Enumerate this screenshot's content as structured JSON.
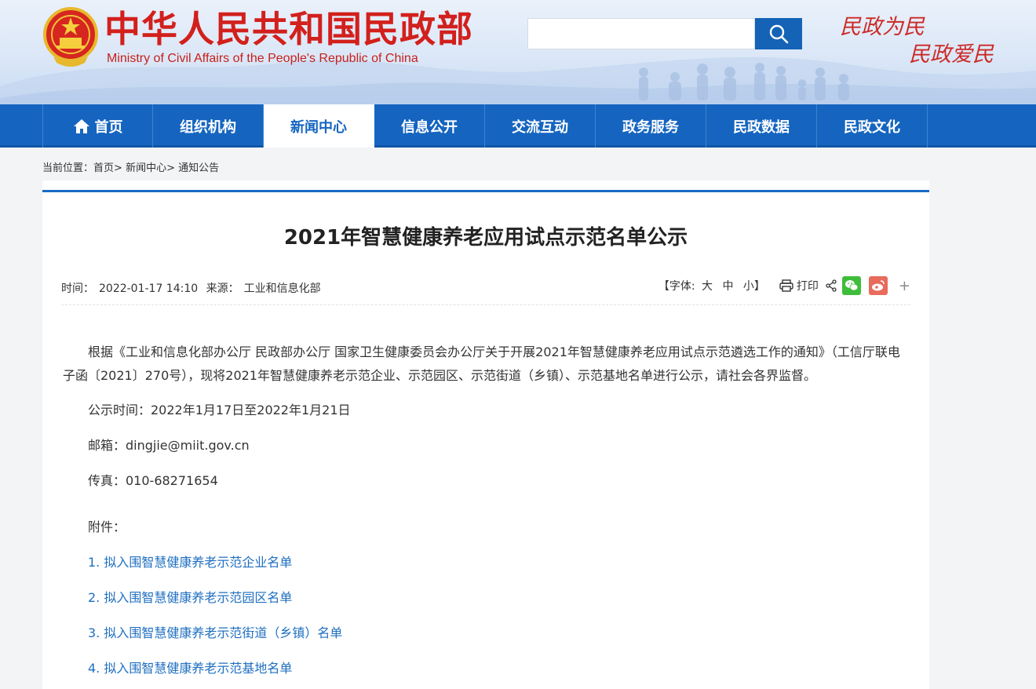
{
  "header": {
    "title_cn": "中华人民共和国民政部",
    "title_en": "Ministry of Civil Affairs of the People's Republic of China",
    "search_placeholder": "",
    "slogan_line1": "民政为民",
    "slogan_line2": "民政爱民",
    "colors": {
      "brand_red": "#d2201c",
      "brand_blue": "#1565c0"
    }
  },
  "nav": {
    "items": [
      {
        "label": "首页",
        "icon": "home-icon"
      },
      {
        "label": "组织机构"
      },
      {
        "label": "新闻中心",
        "active": true
      },
      {
        "label": "信息公开"
      },
      {
        "label": "交流互动"
      },
      {
        "label": "政务服务"
      },
      {
        "label": "民政数据"
      },
      {
        "label": "民政文化"
      }
    ]
  },
  "breadcrumb": {
    "prefix": "当前位置：",
    "items": [
      "首页",
      "新闻中心",
      "通知公告"
    ],
    "separator": "> "
  },
  "article": {
    "title": "2021年智慧健康养老应用试点示范名单公示",
    "time_label": "时间：",
    "time": "2022-01-17 14:10",
    "source_label": "来源：",
    "source": "工业和信息化部",
    "font_label": "【字体:",
    "font_large": "大",
    "font_medium": "中",
    "font_small": "小】",
    "print_label": "打印",
    "more_label": "+",
    "body": "根据《工业和信息化部办公厅 民政部办公厅 国家卫生健康委员会办公厅关于开展2021年智慧健康养老应用试点示范遴选工作的通知》（工信厅联电子函〔2021〕270号），现将2021年智慧健康养老示范企业、示范园区、示范街道（乡镇）、示范基地名单进行公示，请社会各界监督。",
    "period": "公示时间：2022年1月17日至2022年1月21日",
    "email": "邮箱：dingjie@miit.gov.cn",
    "fax": "传真：010-68271654",
    "attachments_label": "附件：",
    "attachments": [
      "1. 拟入围智慧健康养老示范企业名单",
      "2. 拟入围智慧健康养老示范园区名单",
      "3. 拟入围智慧健康养老示范街道（乡镇）名单",
      "4. 拟入围智慧健康养老示范基地名单"
    ]
  }
}
